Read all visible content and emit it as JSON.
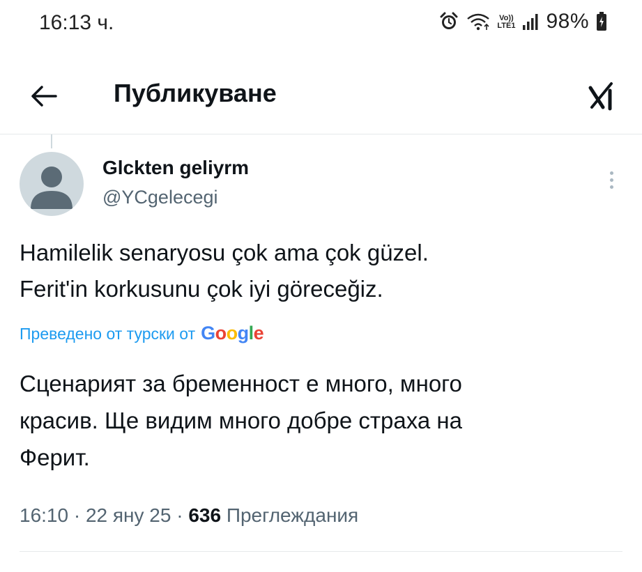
{
  "status_bar": {
    "time": "16:13 ч.",
    "network": "LTE1",
    "network_top": "Vo))",
    "battery": "98%",
    "icons": [
      "alarm-icon",
      "wifi-icon",
      "volte-icon",
      "signal-icon",
      "battery-charging-icon"
    ]
  },
  "header": {
    "back_icon": "arrow-left-icon",
    "title": "Публикуване",
    "grok_icon": "grok-icon"
  },
  "tweet": {
    "author": {
      "name": "Glckten geliyrm",
      "handle": "@YCgelecegi"
    },
    "text_lines": [
      "Hamilelik senaryosu çok ama çok güzel.",
      "Ferit'in korkusunu çok iyi göreceğiz."
    ],
    "translation_label": "Преведено от турски от",
    "translation_provider": "Google",
    "translated_lines": [
      "Сценарият за бременност е много, много",
      "красив. Ще видим много добре страха на",
      "Ферит."
    ],
    "meta": {
      "time": "16:10",
      "separator": "·",
      "date": "22 яну 25",
      "views_count": "636",
      "views_label": "Преглеждания"
    }
  },
  "colors": {
    "text": "#0f1419",
    "secondary": "#536471",
    "link": "#1d9bf0",
    "divider": "#e6e9eb",
    "avatar_bg": "#cfd9de"
  }
}
